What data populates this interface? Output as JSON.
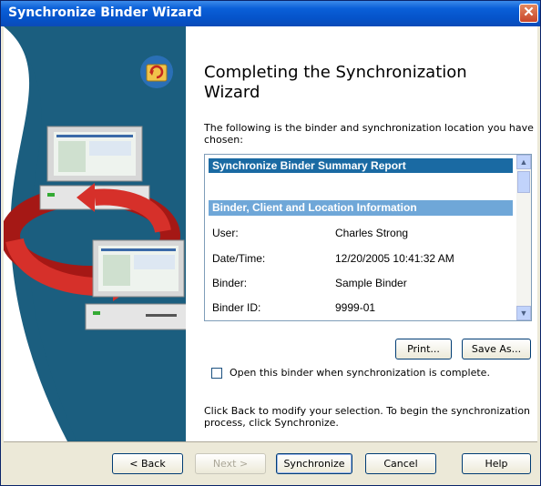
{
  "window": {
    "title": "Synchronize Binder Wizard"
  },
  "main": {
    "heading": "Completing the Synchronization Wizard",
    "intro": "The following is the binder and synchronization location you have chosen:",
    "report": {
      "title": "Synchronize Binder Summary Report",
      "section": "Binder, Client and Location Information",
      "rows": [
        {
          "label": "User:",
          "value": "Charles Strong"
        },
        {
          "label": "Date/Time:",
          "value": "12/20/2005 10:41:32 AM"
        },
        {
          "label": "Binder:",
          "value": "Sample Binder"
        },
        {
          "label": "Binder ID:",
          "value": "9999-01"
        }
      ]
    },
    "print_label": "Print...",
    "save_as_label": "Save As...",
    "open_binder_checkbox": {
      "label": "Open this binder when synchronization is complete.",
      "checked": false
    },
    "bottom_text": "Click Back to modify your selection. To begin the synchronization process, click Synchronize."
  },
  "footer": {
    "back_label": "< Back",
    "next_label": "Next >",
    "synchronize_label": "Synchronize",
    "cancel_label": "Cancel",
    "help_label": "Help"
  },
  "icons": {
    "wizard_icon": "sync-folder-icon",
    "illustration": "computers-sync-illustration"
  },
  "colors": {
    "title_bar": "#0553c9",
    "report_header": "#1a6aa3",
    "report_section": "#6fa7d8",
    "left_panel": "#1b5e7f"
  }
}
